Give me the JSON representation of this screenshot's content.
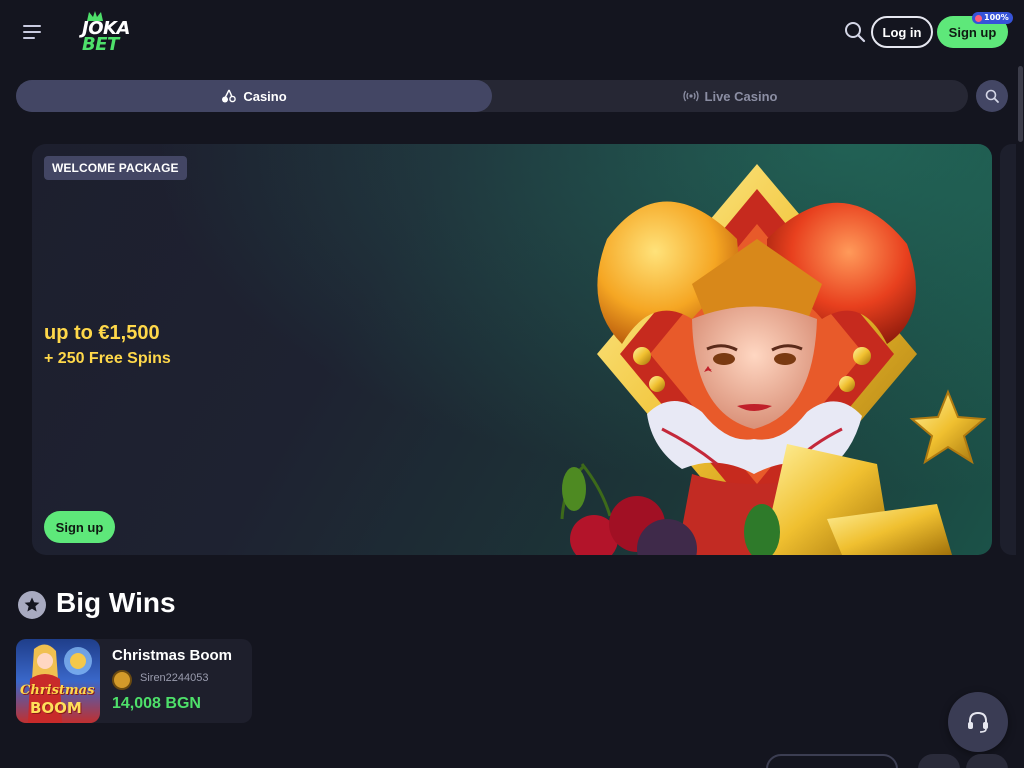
{
  "header": {
    "logo_top": "JOKA",
    "logo_bottom": "BET",
    "login_label": "Log in",
    "signup_label": "Sign up",
    "bonus_badge": "100%",
    "icons": [
      "menu-icon",
      "search-icon"
    ]
  },
  "tabs": [
    {
      "label": "Casino",
      "icon": "cherries-icon",
      "active": true
    },
    {
      "label": "Live Casino",
      "icon": "broadcast-icon",
      "active": false
    }
  ],
  "banner": {
    "tag": "WELCOME PACKAGE",
    "offer_main": "up to €1,500",
    "offer_sub": "+ 250 Free Spins",
    "cta_label": "Sign up"
  },
  "big_wins": {
    "title": "Big Wins",
    "icon": "star-icon",
    "items": [
      {
        "game": "Christmas Boom",
        "thumb_line1": "Christmas",
        "thumb_line2": "BOOM",
        "user": "Siren2244053",
        "amount": "14,008 BGN"
      }
    ]
  },
  "support": {
    "icon": "headset-icon"
  },
  "colors": {
    "background": "#14151f",
    "accent_green": "#5ee87a",
    "offer_yellow": "#ffd84a",
    "tab_active": "#434664",
    "badge_blue": "#3653d8"
  }
}
